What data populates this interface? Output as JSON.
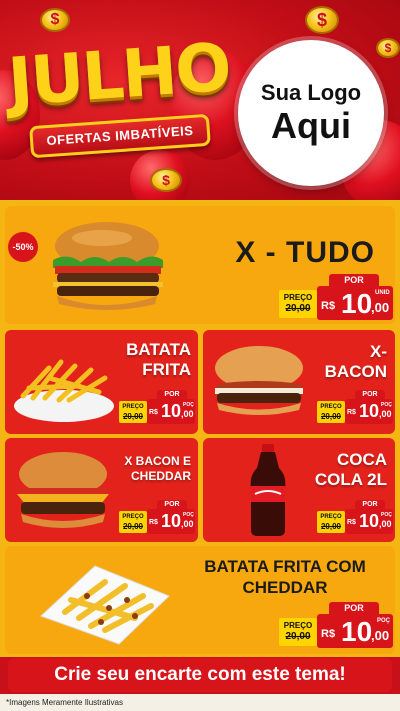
{
  "header": {
    "headline": "JULHO",
    "subtitle": "OFERTAS IMBATÍVEIS",
    "logo_line1": "Sua Logo",
    "logo_line2": "Aqui",
    "coin_symbol": "$"
  },
  "products": [
    {
      "name": "X - TUDO",
      "badge": "-50%",
      "por": "POR",
      "preco_label": "PREÇO",
      "old_price": "20,00",
      "currency": "R$",
      "price_int": "10",
      "price_cents": ",00",
      "unit": "UNID"
    },
    {
      "name_line1": "BATATA",
      "name_line2": "FRITA",
      "por": "POR",
      "preco_label": "PREÇO",
      "old_price": "20,00",
      "currency": "R$",
      "price_int": "10",
      "price_cents": ",00",
      "unit": "POÇ"
    },
    {
      "name_line1": "X-",
      "name_line2": "BACON",
      "por": "POR",
      "preco_label": "PREÇO",
      "old_price": "20,00",
      "currency": "R$",
      "price_int": "10",
      "price_cents": ",00",
      "unit": "POÇ"
    },
    {
      "name_line1": "X BACON E",
      "name_line2": "CHEDDAR",
      "por": "POR",
      "preco_label": "PREÇO",
      "old_price": "20,00",
      "currency": "R$",
      "price_int": "10",
      "price_cents": ",00",
      "unit": "POÇ"
    },
    {
      "name_line1": "COCA",
      "name_line2": "COLA 2L",
      "por": "POR",
      "preco_label": "PREÇO",
      "old_price": "20,00",
      "currency": "R$",
      "price_int": "10",
      "price_cents": ",00",
      "unit": "POÇ"
    },
    {
      "name_line1": "BATATA FRITA COM",
      "name_line2": "CHEDDAR",
      "por": "POR",
      "preco_label": "PREÇO",
      "old_price": "20,00",
      "currency": "R$",
      "price_int": "10",
      "price_cents": ",00",
      "unit": "POÇ"
    }
  ],
  "cta": "Crie seu encarte com este tema!",
  "footnote": "*Imagens Meramente Ilustrativas",
  "colors": {
    "red": "#d8141b",
    "yellow": "#f5b614",
    "gold": "#ffd21a"
  }
}
